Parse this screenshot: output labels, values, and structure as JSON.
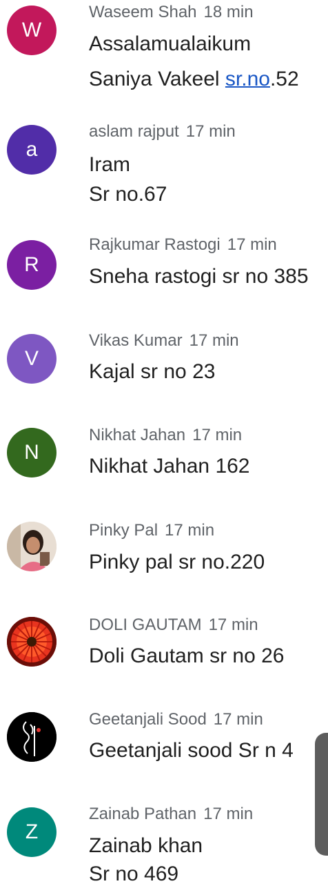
{
  "comments": [
    {
      "author": "Waseem Shah",
      "time": "18 min",
      "avatar_letter": "W",
      "avatar_color": "#c2185b",
      "line1": "Assalamualaikum",
      "line2_prefix": "Saniya Vakeel ",
      "line2_link": "sr.no",
      "line2_suffix": ".52"
    },
    {
      "author": "aslam rajput",
      "time": "17 min",
      "avatar_letter": "a",
      "avatar_color": "#512da8",
      "line1": "Iram",
      "line2": "Sr no.67"
    },
    {
      "author": "Rajkumar Rastogi",
      "time": "17 min",
      "avatar_letter": "R",
      "avatar_color": "#7b1fa2",
      "line1": "Sneha rastogi sr no 385"
    },
    {
      "author": "Vikas Kumar",
      "time": "17 min",
      "avatar_letter": "V",
      "avatar_color": "#7e57c2",
      "line1": "Kajal sr no 23"
    },
    {
      "author": "Nikhat Jahan",
      "time": "17 min",
      "avatar_letter": "N",
      "avatar_color": "#33691e",
      "line1": "Nikhat Jahan 162"
    },
    {
      "author": "Pinky Pal",
      "time": "17 min",
      "avatar_type": "photo",
      "line1": "Pinky pal sr no.220"
    },
    {
      "author": "DOLI GAUTAM",
      "time": "17 min",
      "avatar_type": "flower-photo",
      "line1": "Doli Gautam sr no 26"
    },
    {
      "author": "Geetanjali Sood",
      "time": "17 min",
      "avatar_type": "black-art",
      "line1": "Geetanjali sood Sr n 4"
    },
    {
      "author": "Zainab Pathan",
      "time": "17 min",
      "avatar_letter": "Z",
      "avatar_color": "#00897b",
      "line1": "Zainab khan",
      "line2": "Sr no 469"
    }
  ]
}
